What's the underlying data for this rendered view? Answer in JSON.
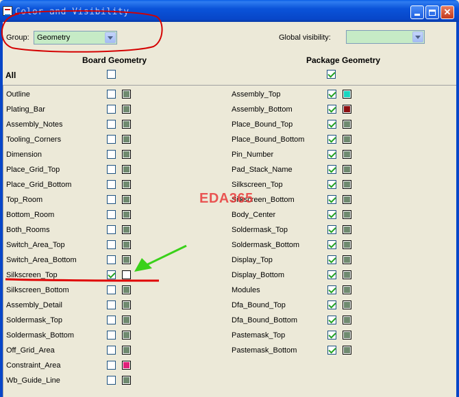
{
  "window": {
    "title": "Color and Visibility",
    "buttons": {
      "minimize": "_",
      "maximize": "□",
      "close": "✕"
    }
  },
  "group": {
    "label": "Group:",
    "value": "Geometry"
  },
  "global_visibility": {
    "label": "Global visibility:",
    "value": ""
  },
  "headers": {
    "board": "Board Geometry",
    "package": "Package Geometry",
    "all": "All"
  },
  "all_checks": {
    "board": false,
    "package": true
  },
  "board_items": [
    {
      "name": "Outline",
      "checked": false,
      "color": "#6f8a6f"
    },
    {
      "name": "Plating_Bar",
      "checked": false,
      "color": "#6f8a6f"
    },
    {
      "name": "Assembly_Notes",
      "checked": false,
      "color": "#6f8a6f"
    },
    {
      "name": "Tooling_Corners",
      "checked": false,
      "color": "#6f8a6f"
    },
    {
      "name": "Dimension",
      "checked": false,
      "color": "#6f8a6f"
    },
    {
      "name": "Place_Grid_Top",
      "checked": false,
      "color": "#6f8a6f"
    },
    {
      "name": "Place_Grid_Bottom",
      "checked": false,
      "color": "#6f8a6f"
    },
    {
      "name": "Top_Room",
      "checked": false,
      "color": "#6f8a6f"
    },
    {
      "name": "Bottom_Room",
      "checked": false,
      "color": "#6f8a6f"
    },
    {
      "name": "Both_Rooms",
      "checked": false,
      "color": "#6f8a6f"
    },
    {
      "name": "Switch_Area_Top",
      "checked": false,
      "color": "#6f8a6f"
    },
    {
      "name": "Switch_Area_Bottom",
      "checked": false,
      "color": "#6f8a6f"
    },
    {
      "name": "Silkscreen_Top",
      "checked": true,
      "color": "#ffffff"
    },
    {
      "name": "Silkscreen_Bottom",
      "checked": false,
      "color": "#6f8a6f"
    },
    {
      "name": "Assembly_Detail",
      "checked": false,
      "color": "#6f8a6f"
    },
    {
      "name": "Soldermask_Top",
      "checked": false,
      "color": "#6f8a6f"
    },
    {
      "name": "Soldermask_Bottom",
      "checked": false,
      "color": "#6f8a6f"
    },
    {
      "name": "Off_Grid_Area",
      "checked": false,
      "color": "#6f8a6f"
    },
    {
      "name": "Constraint_Area",
      "checked": false,
      "color": "#e0207a"
    },
    {
      "name": "Wb_Guide_Line",
      "checked": false,
      "color": "#6f8a6f"
    }
  ],
  "package_items": [
    {
      "name": "Assembly_Top",
      "checked": true,
      "color": "#19d6c0"
    },
    {
      "name": "Assembly_Bottom",
      "checked": true,
      "color": "#8b0f0f"
    },
    {
      "name": "Place_Bound_Top",
      "checked": true,
      "color": "#6f8a6f"
    },
    {
      "name": "Place_Bound_Bottom",
      "checked": true,
      "color": "#6f8a6f"
    },
    {
      "name": "Pin_Number",
      "checked": true,
      "color": "#6f8a6f"
    },
    {
      "name": "Pad_Stack_Name",
      "checked": true,
      "color": "#6f8a6f"
    },
    {
      "name": "Silkscreen_Top",
      "checked": true,
      "color": "#6f8a6f"
    },
    {
      "name": "Silkscreen_Bottom",
      "checked": true,
      "color": "#6f8a6f"
    },
    {
      "name": "Body_Center",
      "checked": true,
      "color": "#6f8a6f"
    },
    {
      "name": "Soldermask_Top",
      "checked": true,
      "color": "#6f8a6f"
    },
    {
      "name": "Soldermask_Bottom",
      "checked": true,
      "color": "#6f8a6f"
    },
    {
      "name": "Display_Top",
      "checked": true,
      "color": "#6f8a6f"
    },
    {
      "name": "Display_Bottom",
      "checked": true,
      "color": "#6f8a6f"
    },
    {
      "name": "Modules",
      "checked": true,
      "color": "#6f8a6f"
    },
    {
      "name": "Dfa_Bound_Top",
      "checked": true,
      "color": "#6f8a6f"
    },
    {
      "name": "Dfa_Bound_Bottom",
      "checked": true,
      "color": "#6f8a6f"
    },
    {
      "name": "Pastemask_Top",
      "checked": true,
      "color": "#6f8a6f"
    },
    {
      "name": "Pastemask_Bottom",
      "checked": true,
      "color": "#6f8a6f"
    }
  ],
  "watermark": "EDA365",
  "annotation_colors": {
    "circle": "#d40000",
    "underline": "#e00000",
    "arrow": "#3ad11a"
  }
}
